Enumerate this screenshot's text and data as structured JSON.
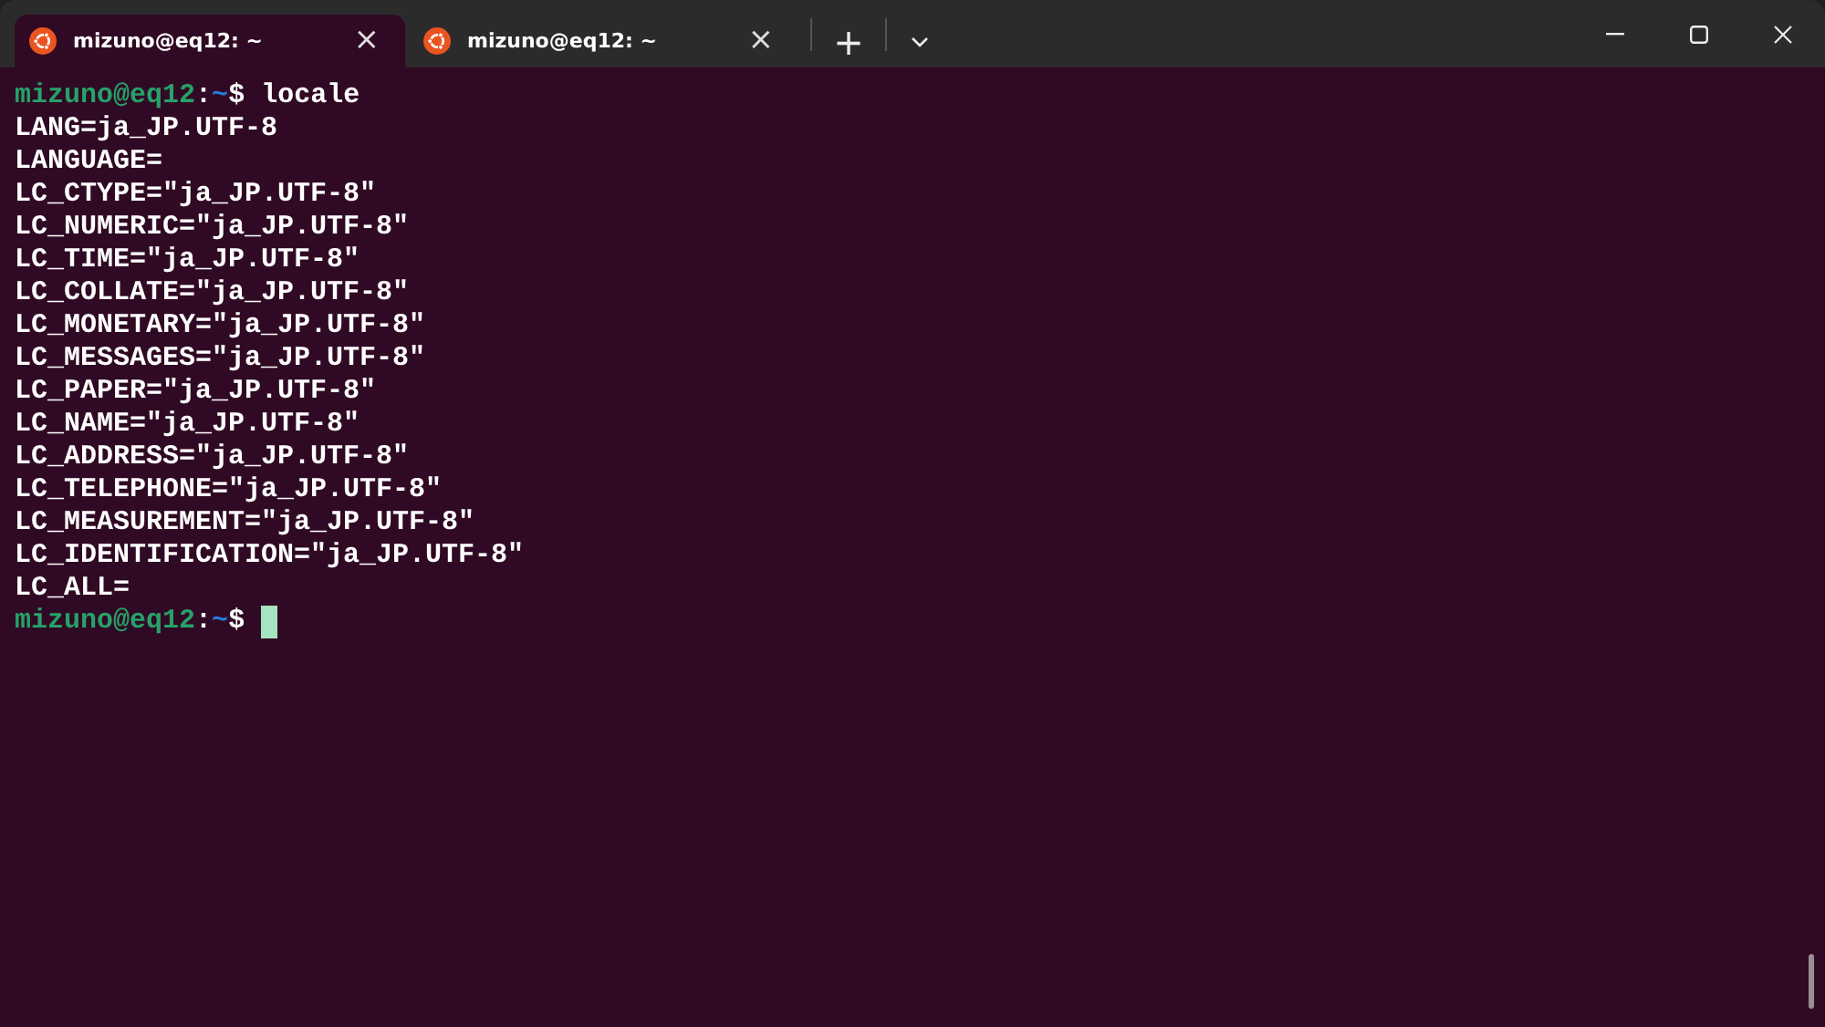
{
  "tabs": [
    {
      "title": "mizuno@eq12: ~",
      "close": "×",
      "selected": true
    },
    {
      "title": "mizuno@eq12: ~",
      "close": "×",
      "selected": false
    }
  ],
  "new_tab": "+",
  "terminal": {
    "lines": [
      {
        "kind": "prompt",
        "user_host": "mizuno@eq12",
        "sep": ":",
        "path": "~",
        "sign": "$",
        "command": "locale"
      },
      {
        "kind": "output",
        "text": "LANG=ja_JP.UTF-8"
      },
      {
        "kind": "output",
        "text": "LANGUAGE="
      },
      {
        "kind": "output",
        "text": "LC_CTYPE=\"ja_JP.UTF-8\""
      },
      {
        "kind": "output",
        "text": "LC_NUMERIC=\"ja_JP.UTF-8\""
      },
      {
        "kind": "output",
        "text": "LC_TIME=\"ja_JP.UTF-8\""
      },
      {
        "kind": "output",
        "text": "LC_COLLATE=\"ja_JP.UTF-8\""
      },
      {
        "kind": "output",
        "text": "LC_MONETARY=\"ja_JP.UTF-8\""
      },
      {
        "kind": "output",
        "text": "LC_MESSAGES=\"ja_JP.UTF-8\""
      },
      {
        "kind": "output",
        "text": "LC_PAPER=\"ja_JP.UTF-8\""
      },
      {
        "kind": "output",
        "text": "LC_NAME=\"ja_JP.UTF-8\""
      },
      {
        "kind": "output",
        "text": "LC_ADDRESS=\"ja_JP.UTF-8\""
      },
      {
        "kind": "output",
        "text": "LC_TELEPHONE=\"ja_JP.UTF-8\""
      },
      {
        "kind": "output",
        "text": "LC_MEASUREMENT=\"ja_JP.UTF-8\""
      },
      {
        "kind": "output",
        "text": "LC_IDENTIFICATION=\"ja_JP.UTF-8\""
      },
      {
        "kind": "output",
        "text": "LC_ALL="
      },
      {
        "kind": "prompt",
        "user_host": "mizuno@eq12",
        "sep": ":",
        "path": "~",
        "sign": "$",
        "cursor": true
      }
    ]
  }
}
